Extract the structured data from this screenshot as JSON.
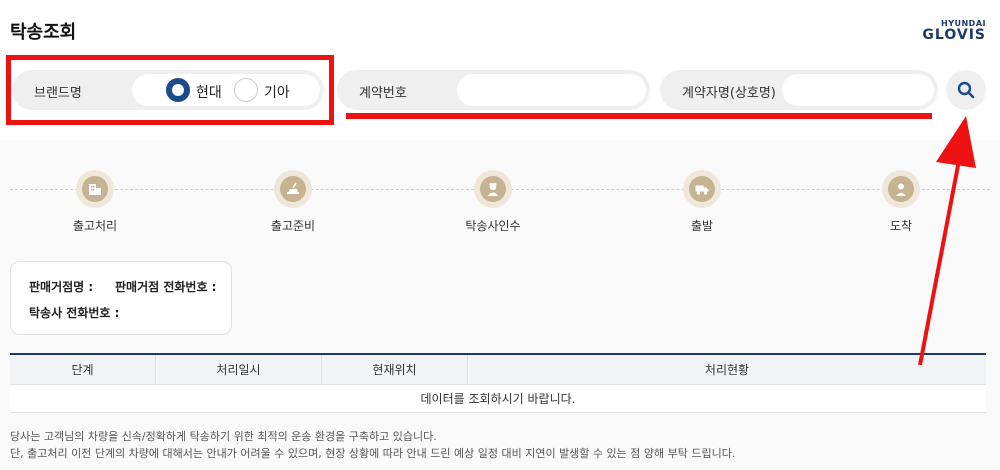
{
  "header": {
    "title": "탁송조회",
    "logo_top": "HYUNDAI",
    "logo_bottom": "GLOVIS"
  },
  "search": {
    "brand": {
      "label": "브랜드명",
      "options": [
        "현대",
        "기아"
      ],
      "selected": "현대"
    },
    "contract_no": {
      "label": "계약번호",
      "value": ""
    },
    "contractor": {
      "label": "계약자명(상호명)",
      "value": ""
    },
    "search_icon": "magnifier-icon"
  },
  "steps": [
    {
      "label": "출고처리",
      "icon": "building-icon"
    },
    {
      "label": "출고준비",
      "icon": "car-wash-icon"
    },
    {
      "label": "탁송사인수",
      "icon": "driver-icon"
    },
    {
      "label": "출발",
      "icon": "truck-icon"
    },
    {
      "label": "도착",
      "icon": "person-icon"
    }
  ],
  "dealer": {
    "name_label": "판매거점명 :",
    "phone_label": "판매거점 전화번호 :",
    "carrier_phone_label": "탁송사 전화번호 :"
  },
  "table": {
    "headers": [
      "단계",
      "처리일시",
      "현재위치",
      "처리현황"
    ],
    "empty_message": "데이터를 조회하시기 바랍니다."
  },
  "notice": [
    "당사는 고객님의 차량을 신속/정확하게 탁송하기 위한 최적의 운송 환경을 구축하고 있습니다.",
    "단, 출고처리 이전 단계의 차량에 대해서는 안내가 어려울 수 있으며, 현장 상황에 따라 안내 드린 예상 일정 대비 지연이 발생할 수 있는 점 양해 부탁 드립니다."
  ],
  "colors": {
    "accent": "#1c4a8a",
    "annotation": "#ee1111",
    "step_icon": "#c6b391"
  }
}
